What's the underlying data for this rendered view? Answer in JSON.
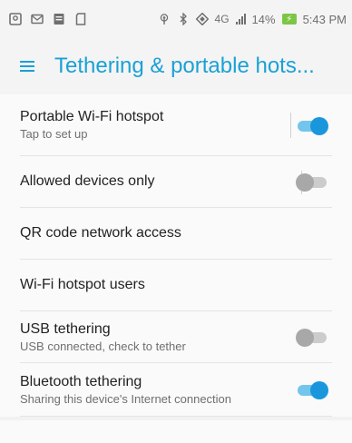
{
  "status_bar": {
    "left_icons": [
      "photo-icon",
      "message-icon",
      "notes-icon",
      "sd-card-icon"
    ],
    "right_icons": [
      "hotspot-icon",
      "bluetooth-icon",
      "wifi-calling-icon"
    ],
    "network": "4G",
    "battery_percent": "14%",
    "battery_label": "⚡",
    "time": "5:43 PM"
  },
  "app_bar": {
    "menu_icon": "hamburger-menu-icon",
    "title": "Tethering & portable hots..."
  },
  "settings": [
    {
      "title": "Portable Wi-Fi hotspot",
      "subtitle": "Tap to set up",
      "toggle": true,
      "divider": true
    },
    {
      "title": "Allowed devices only",
      "subtitle": "",
      "toggle": false,
      "divider": true
    },
    {
      "title": "QR code network access",
      "subtitle": ""
    },
    {
      "title": "Wi-Fi hotspot users",
      "subtitle": ""
    },
    {
      "title": "USB tethering",
      "subtitle": "USB connected, check to tether",
      "toggle": false
    },
    {
      "title": "Bluetooth tethering",
      "subtitle": "Sharing this device's Internet connection",
      "toggle": true
    }
  ],
  "colors": {
    "accent": "#1aa1d6",
    "toggle_on_thumb": "#1a97dc",
    "toggle_on_track": "#73c5ec",
    "toggle_off_thumb": "#a8a8a8",
    "toggle_off_track": "#cccccc"
  }
}
